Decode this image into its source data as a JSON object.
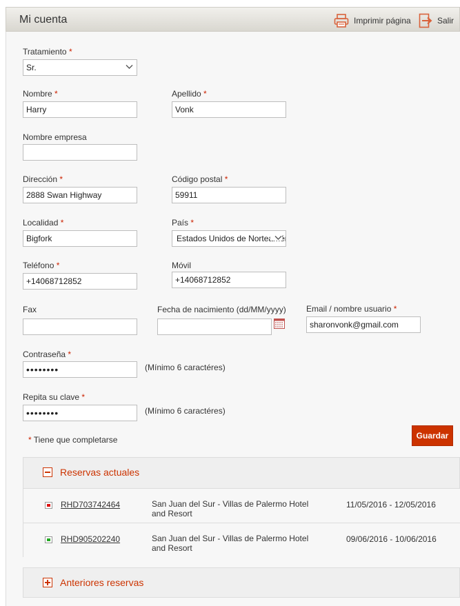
{
  "header": {
    "title": "Mi cuenta",
    "print_label": "Imprimir página",
    "logout_label": "Salir"
  },
  "form": {
    "required_mark": "*",
    "tratamiento": {
      "label": "Tratamiento",
      "value": "Sr."
    },
    "nombre": {
      "label": "Nombre",
      "value": "Harry"
    },
    "apellido": {
      "label": "Apellido",
      "value": "Vonk"
    },
    "empresa": {
      "label": "Nombre empresa",
      "value": ""
    },
    "direccion": {
      "label": "Dirección",
      "value": "2888 Swan Highway"
    },
    "codigo_postal": {
      "label": "Código postal",
      "value": "59911"
    },
    "localidad": {
      "label": "Localidad",
      "value": "Bigfork"
    },
    "pais": {
      "label": "País",
      "value": "Estados Unidos de Norteamérica"
    },
    "telefono": {
      "label": "Teléfono",
      "value": "+14068712852"
    },
    "movil": {
      "label": "Móvil",
      "value": "+14068712852"
    },
    "fax": {
      "label": "Fax",
      "value": ""
    },
    "nacimiento": {
      "label": "Fecha de nacimiento (dd/MM/yyyy)",
      "value": ""
    },
    "email": {
      "label": "Email / nombre usuario",
      "value": "sharonvonk@gmail.com"
    },
    "contrasena": {
      "label": "Contraseña",
      "value": "••••••••",
      "hint": "(Mínimo 6 caractéres)"
    },
    "repita": {
      "label": "Repita su clave",
      "value": "••••••••",
      "hint": "(Mínimo 6 caractéres)"
    },
    "required_note": "Tiene que completarse",
    "save_label": "Guardar"
  },
  "reservas_actuales": {
    "title": "Reservas actuales",
    "toggle": "−",
    "items": [
      {
        "code": "RHD703742464",
        "hotel": "San Juan del Sur - Villas de Palermo Hotel and Resort",
        "dates": "11/05/2016 - 12/05/2016",
        "status_color": "#dd1111"
      },
      {
        "code": "RHD905202240",
        "hotel": "San Juan del Sur - Villas de Palermo Hotel and Resort",
        "dates": "09/06/2016 - 10/06/2016",
        "status_color": "#22aa22"
      }
    ]
  },
  "anteriores_reservas": {
    "title": "Anteriores reservas",
    "toggle": "+"
  },
  "colors": {
    "accent": "#cc3300",
    "panel_bg": "#f7f7f7",
    "header_bg": "#e2e0da"
  }
}
